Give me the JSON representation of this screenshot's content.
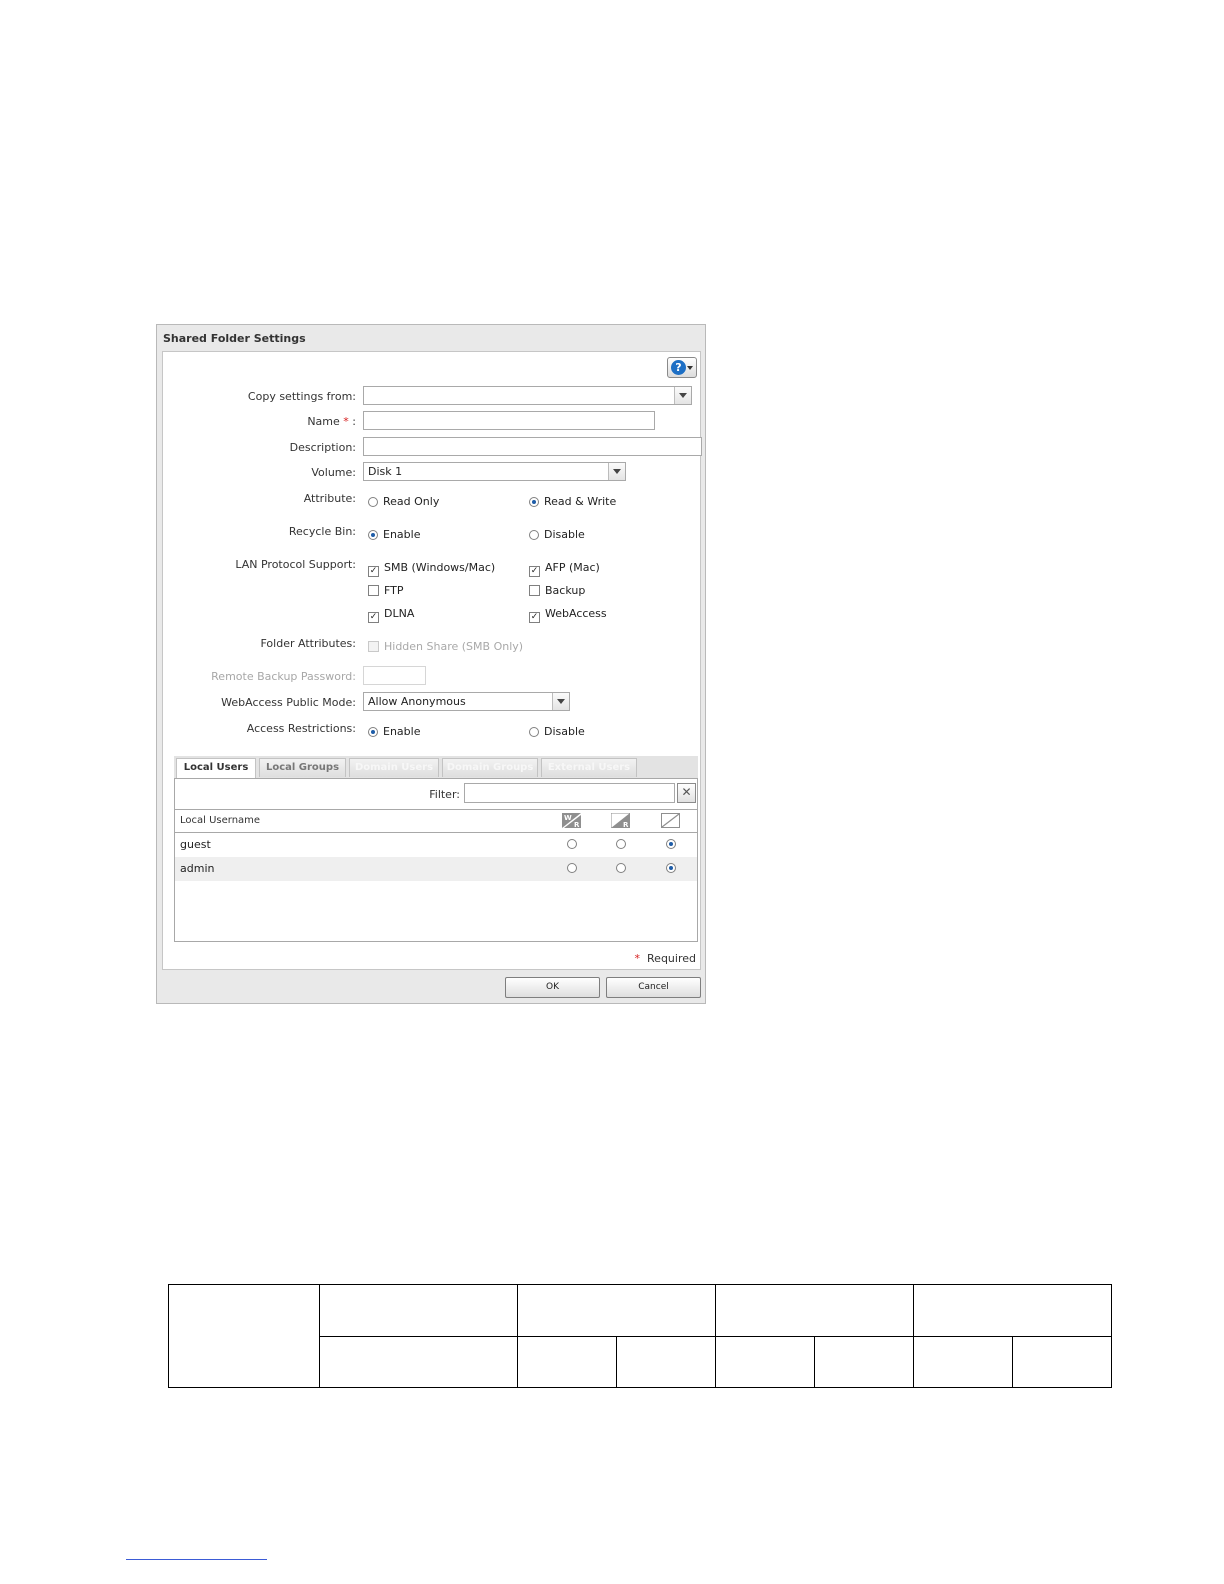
{
  "dialog": {
    "title": "Shared Folder Settings",
    "help_icon": "help-icon",
    "copy_settings": {
      "label": "Copy settings from:",
      "value": ""
    },
    "name": {
      "label": "Name",
      "star": "*",
      "colon": ":",
      "value": ""
    },
    "description": {
      "label": "Description:",
      "value": ""
    },
    "volume": {
      "label": "Volume:",
      "value": "Disk 1"
    },
    "attribute": {
      "label": "Attribute:",
      "options": [
        "Read Only",
        "Read & Write"
      ],
      "selected": "Read & Write"
    },
    "recycle_bin": {
      "label": "Recycle Bin:",
      "options": [
        "Enable",
        "Disable"
      ],
      "selected": "Enable"
    },
    "lan_protocol": {
      "label": "LAN Protocol Support:",
      "items": [
        {
          "label": "SMB (Windows/Mac)",
          "checked": true
        },
        {
          "label": "AFP (Mac)",
          "checked": true
        },
        {
          "label": "FTP",
          "checked": false
        },
        {
          "label": "Backup",
          "checked": false
        },
        {
          "label": "DLNA",
          "checked": true
        },
        {
          "label": "WebAccess",
          "checked": true
        }
      ]
    },
    "folder_attributes": {
      "label": "Folder Attributes:",
      "option": "Hidden Share (SMB Only)",
      "checked": false,
      "disabled": true
    },
    "remote_backup_password": {
      "label": "Remote Backup Password:",
      "value": "",
      "disabled": true
    },
    "webaccess_public_mode": {
      "label": "WebAccess Public Mode:",
      "value": "Allow Anonymous"
    },
    "access_restrictions": {
      "label": "Access Restrictions:",
      "options": [
        "Enable",
        "Disable"
      ],
      "selected": "Enable"
    },
    "tabs": [
      {
        "label": "Local Users",
        "active": true,
        "enabled": true
      },
      {
        "label": "Local Groups",
        "active": false,
        "enabled": true
      },
      {
        "label": "Domain Users",
        "active": false,
        "enabled": false
      },
      {
        "label": "Domain Groups",
        "active": false,
        "enabled": false
      },
      {
        "label": "External Users",
        "active": false,
        "enabled": false
      }
    ],
    "filter": {
      "label": "Filter:",
      "value": "",
      "clear_icon": "close-icon"
    },
    "grid": {
      "column_user": "Local Username",
      "permission_icons": [
        "read-write-icon",
        "read-only-icon",
        "no-access-icon"
      ],
      "rows": [
        {
          "name": "guest",
          "permission": "no-access"
        },
        {
          "name": "admin",
          "permission": "no-access"
        }
      ]
    },
    "required_note": {
      "star": "*",
      "text": "Required"
    },
    "ok_label": "OK",
    "cancel_label": "Cancel"
  },
  "colors": {
    "accent": "#1f5da8",
    "required": "#d62020",
    "link_rule": "#3b5bd6"
  }
}
